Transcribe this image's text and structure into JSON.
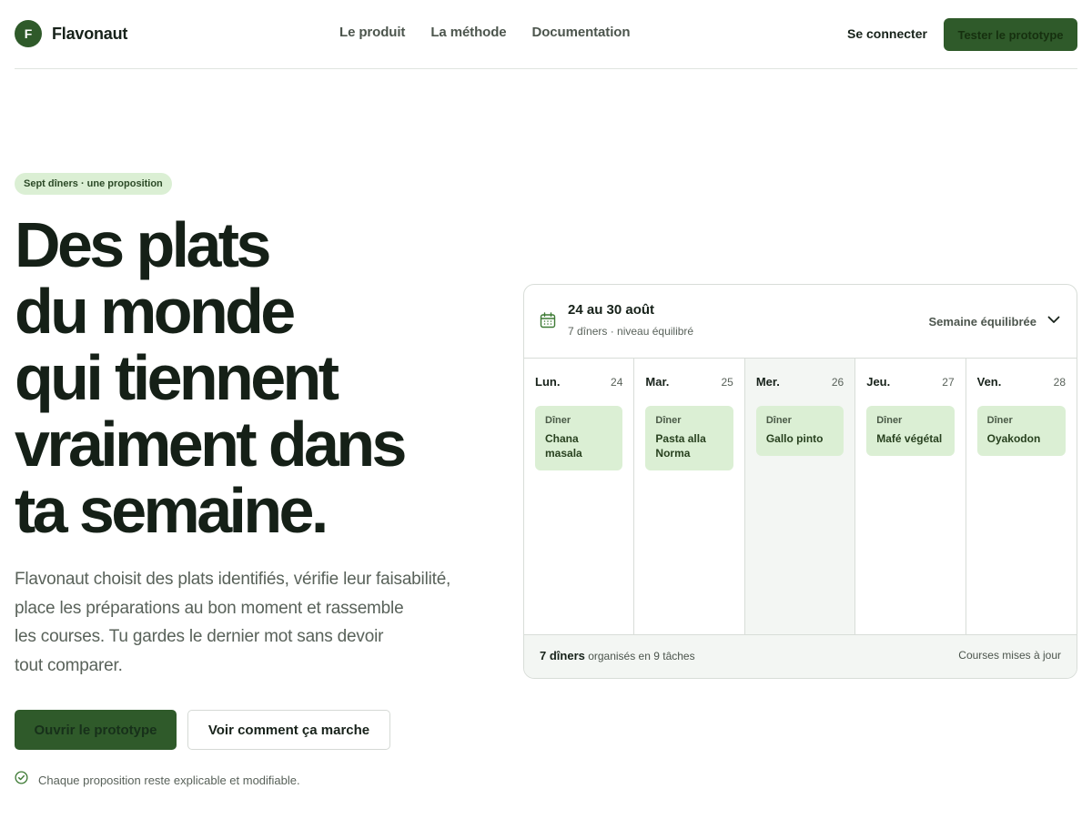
{
  "header": {
    "logo_letter": "F",
    "brand": "Flavonaut",
    "nav": [
      {
        "label": "Le produit"
      },
      {
        "label": "La méthode"
      },
      {
        "label": "Documentation"
      }
    ],
    "login_label": "Se connecter",
    "cta_label": "Tester le prototype"
  },
  "hero": {
    "badge": "Sept dîners · une proposition",
    "headline_lines": [
      "Des plats",
      "du monde",
      "qui tiennent",
      "vraiment dans",
      "ta semaine."
    ],
    "lead_lines": [
      "Flavonaut choisit des plats identifiés, vérifie leur faisabilité,",
      "place les préparations au bon moment et rassemble",
      "les courses. Tu gardes le dernier mot sans devoir",
      "tout comparer."
    ],
    "primary_button": "Ouvrir le prototype",
    "secondary_button": "Voir comment ça marche",
    "note": "Chaque proposition reste explicable et modifiable."
  },
  "planner": {
    "range": "24 au 30 août",
    "range_sub": "7 dîners · niveau équilibré",
    "mode_label": "Semaine équilibrée",
    "days": [
      {
        "name": "Lun.",
        "num": "24",
        "meal_tag": "Dîner",
        "dish": "Chana masala",
        "today": false
      },
      {
        "name": "Mar.",
        "num": "25",
        "meal_tag": "Dîner",
        "dish": "Pasta alla Norma",
        "today": false
      },
      {
        "name": "Mer.",
        "num": "26",
        "meal_tag": "Dîner",
        "dish": "Gallo pinto",
        "today": true
      },
      {
        "name": "Jeu.",
        "num": "27",
        "meal_tag": "Dîner",
        "dish": "Mafé végétal",
        "today": false
      },
      {
        "name": "Ven.",
        "num": "28",
        "meal_tag": "Dîner",
        "dish": "Oyakodon",
        "today": false
      }
    ],
    "footer_count": "7 dîners",
    "footer_rest": " organisés en 9 tâches",
    "footer_right": "Courses mises à jour"
  },
  "colors": {
    "brand_green": "#2f5a2a",
    "meal_tile": "#dbefd4",
    "today_column": "#f3f6f3"
  }
}
